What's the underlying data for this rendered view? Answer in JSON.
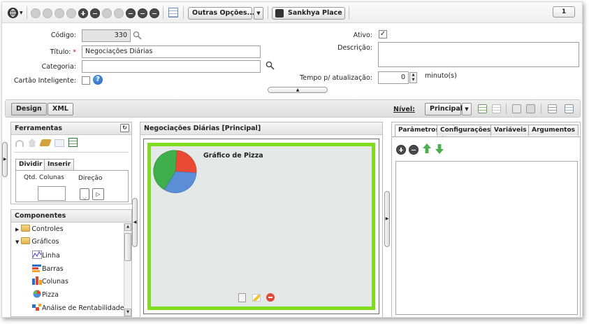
{
  "toolbar": {
    "outras_opcoes": "Outras Opções...",
    "sankhya_place": "Sankhya Place",
    "record_counter": "1"
  },
  "form": {
    "codigo_label": "Código:",
    "codigo_value": "330",
    "titulo_label": "Título:",
    "titulo_required": "*",
    "titulo_value": "Negociações Diárias",
    "categoria_label": "Categoria:",
    "categoria_value": "",
    "cartao_label": "Cartão Inteligente:",
    "ativo_label": "Ativo:",
    "ativo_checked": "✓",
    "descricao_label": "Descrição:",
    "descricao_value": "",
    "tempo_label": "Tempo p/ atualização:",
    "tempo_value": "0",
    "tempo_unit": "minuto(s)"
  },
  "designbar": {
    "design_tab": "Design",
    "xml_tab": "XML",
    "nivel_label": "Nível:",
    "nivel_value": "Principal"
  },
  "ferramentas": {
    "title": "Ferramentas",
    "tabs": [
      "Dividir",
      "Inserir"
    ],
    "qtd_colunas": "Qtd. Colunas",
    "direcao": "Direção"
  },
  "componentes": {
    "title": "Componentes",
    "items": [
      {
        "label": "Controles",
        "icon": "folder-icon"
      },
      {
        "label": "Gráficos",
        "icon": "folder-open-icon"
      },
      {
        "label": "Linha",
        "icon": "line-chart-icon"
      },
      {
        "label": "Barras",
        "icon": "bar-chart-icon"
      },
      {
        "label": "Colunas",
        "icon": "column-chart-icon"
      },
      {
        "label": "Pizza",
        "icon": "pie-chart-icon"
      },
      {
        "label": "Análise de Rentabilidade",
        "icon": "profit-analysis-icon"
      }
    ]
  },
  "canvas": {
    "title": "Negociações Diárias [Principal]",
    "chart_title": "Gráfico de Pizza",
    "frame_color": "#7fdc1e"
  },
  "right_panel": {
    "tabs": [
      "Parâmetros",
      "Configurações",
      "Variáveis",
      "Argumentos"
    ]
  }
}
